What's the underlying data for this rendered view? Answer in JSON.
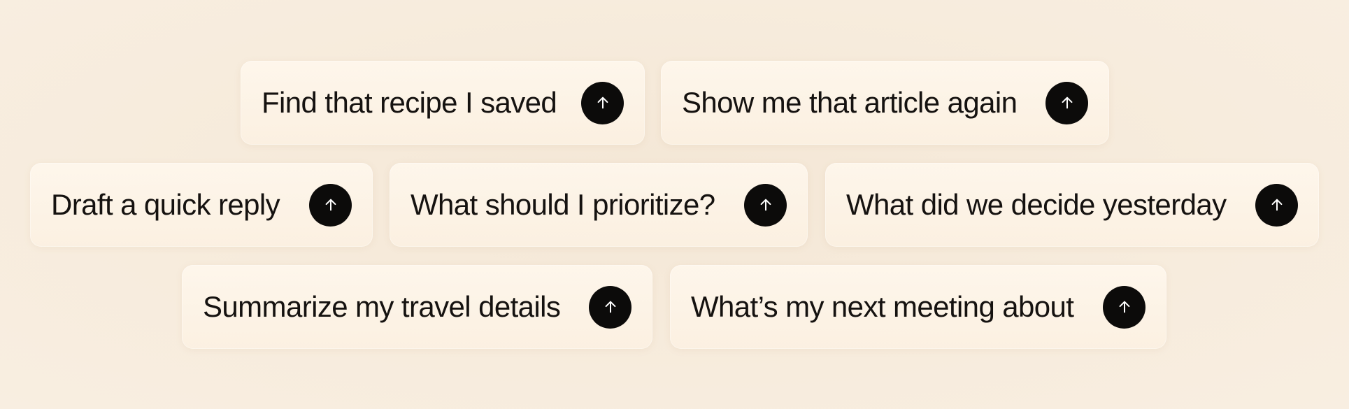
{
  "suggestions": [
    {
      "label": "Find that recipe I saved",
      "icon": "arrow-up-icon"
    },
    {
      "label": "Show me that article again",
      "icon": "arrow-up-icon"
    },
    {
      "label": "Draft a quick reply",
      "icon": "arrow-up-icon"
    },
    {
      "label": "What should I prioritize?",
      "icon": "arrow-up-icon"
    },
    {
      "label": "What did we decide yesterday",
      "icon": "arrow-up-icon"
    },
    {
      "label": "Summarize my travel details",
      "icon": "arrow-up-icon"
    },
    {
      "label": "What’s my next meeting about",
      "icon": "arrow-up-icon"
    }
  ],
  "colors": {
    "background": "#f6ead9",
    "chip": "#fcf2e4",
    "button": "#0c0b0a",
    "text": "#151210"
  }
}
